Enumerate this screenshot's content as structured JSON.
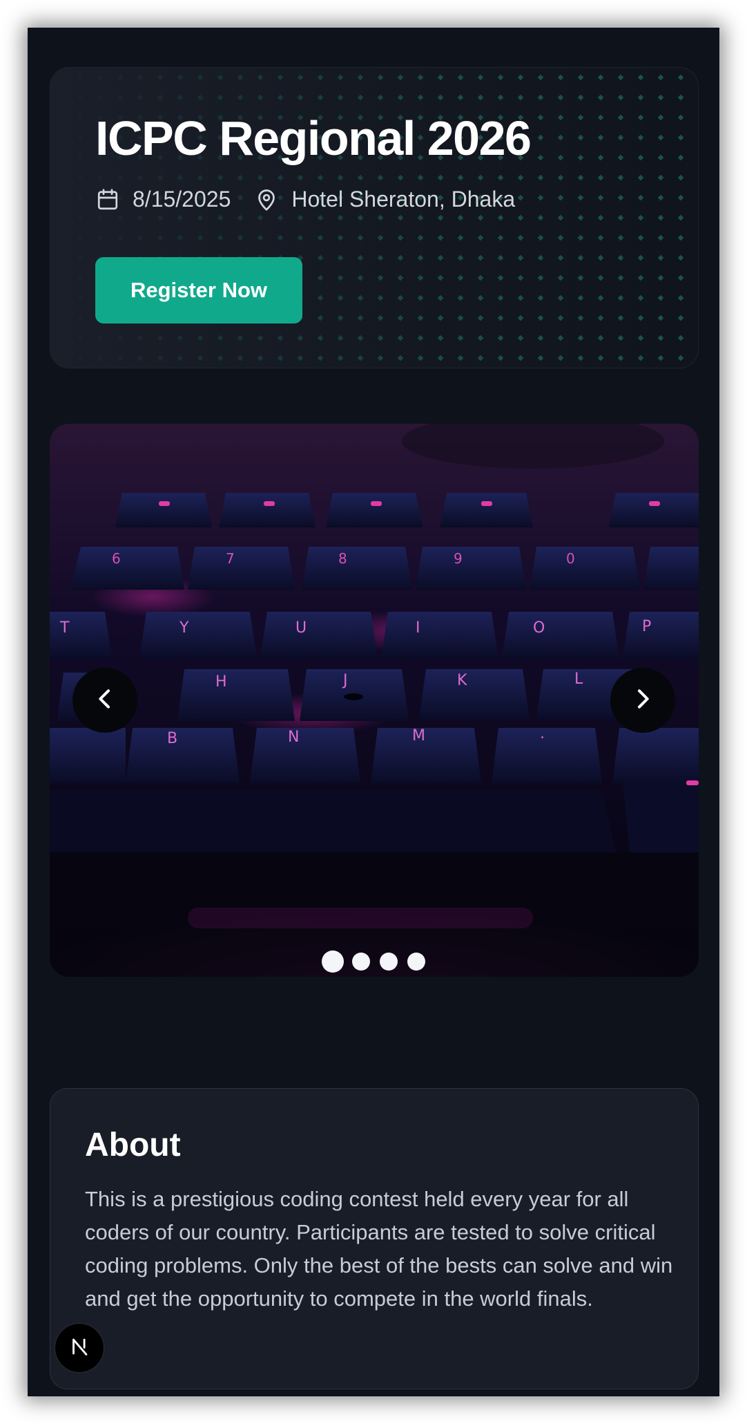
{
  "event": {
    "title": "ICPC Regional 2026",
    "date": "8/15/2025",
    "location": "Hotel Sheraton, Dhaka",
    "register_label": "Register Now",
    "calendar_icon": "calendar-icon",
    "location_icon": "map-pin-icon"
  },
  "carousel": {
    "image_alt": "Backlit mechanical keyboard",
    "prev_icon": "chevron-left-icon",
    "next_icon": "chevron-right-icon",
    "slide_count": 4,
    "active_index": 0
  },
  "about": {
    "title": "About",
    "text": "This is a prestigious coding contest held every year for all coders of our country. Participants are tested to solve critical coding problems. Only the best of the bests can solve and win and get the opportunity to compete in the world finals."
  },
  "dev_badge": {
    "letter": "N",
    "icon": "nextjs-logo-icon"
  },
  "colors": {
    "background": "#0e121b",
    "accent": "#11a98c",
    "card": "#181d27"
  }
}
